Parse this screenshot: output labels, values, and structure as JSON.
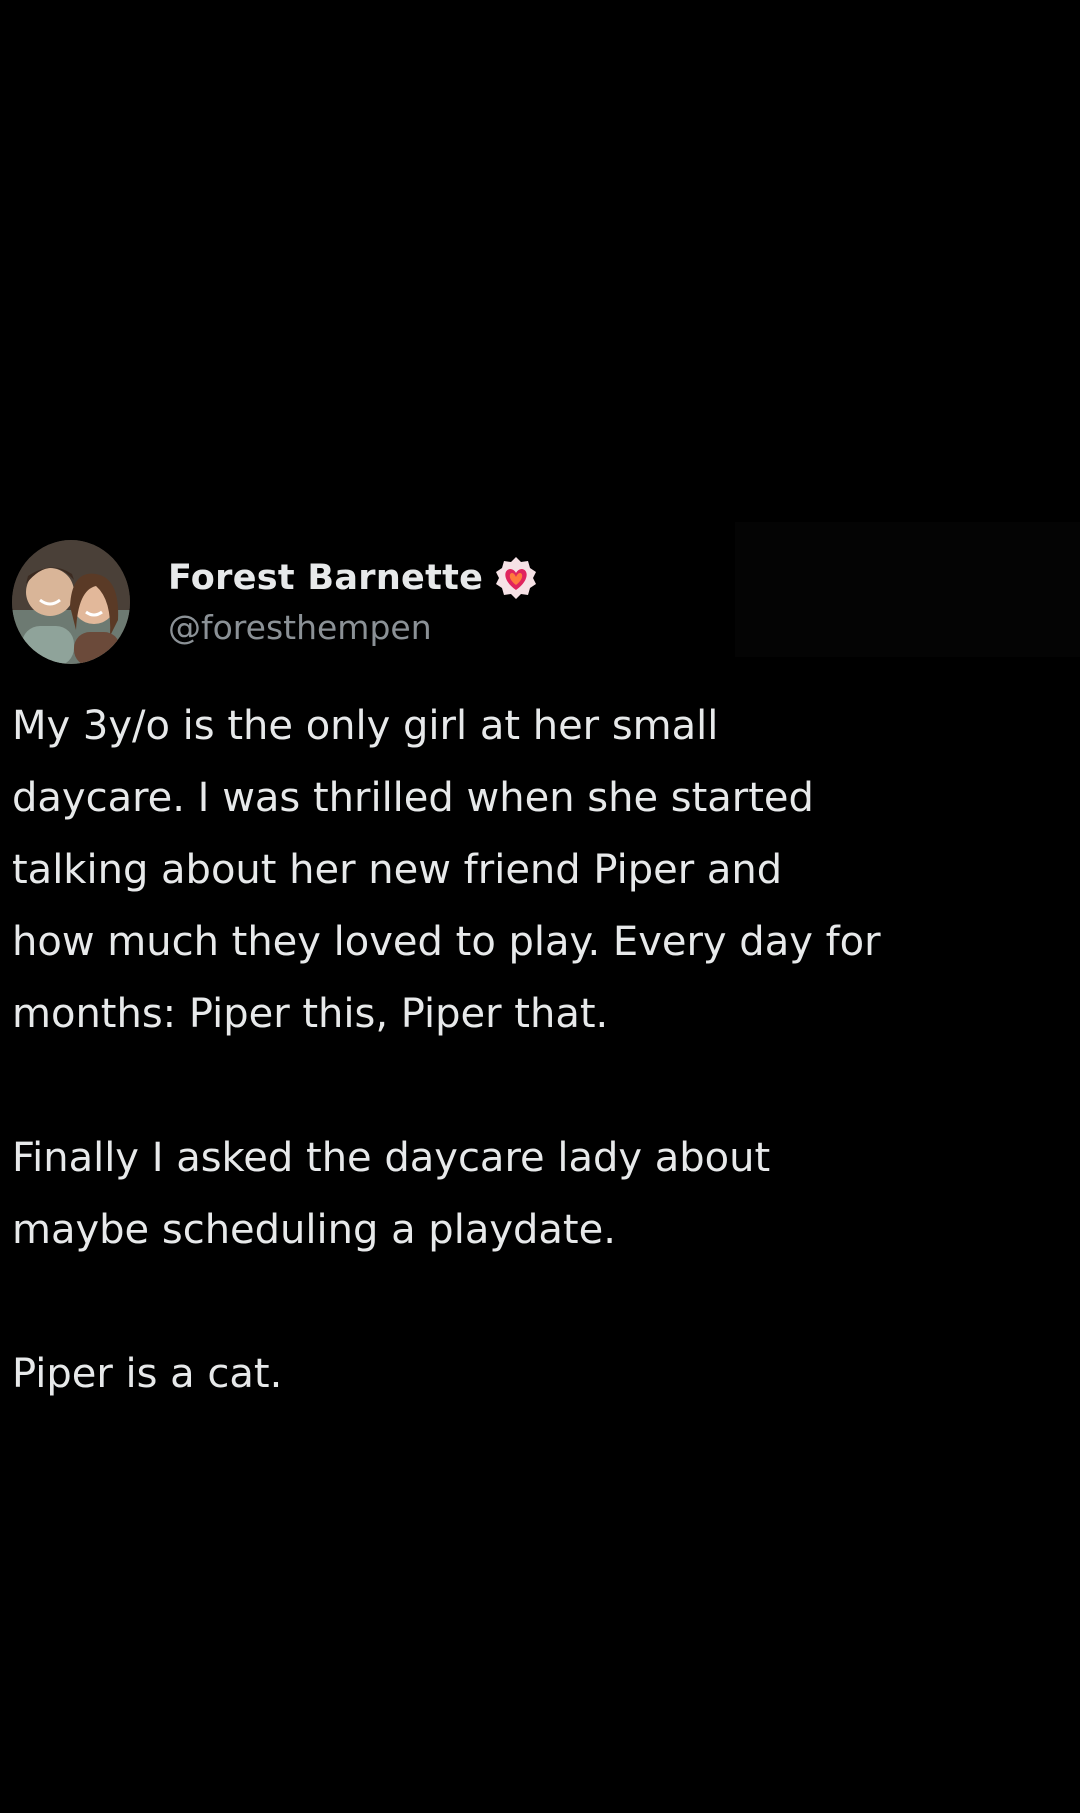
{
  "author": {
    "display_name": "Forest Barnette",
    "handle": "@foresthempen",
    "avatar_icon": "profile-photo",
    "badge_icon": "heart-badge-icon"
  },
  "tweet": {
    "paragraphs": [
      {
        "lines": [
          "My 3y/o is the only girl at her small",
          "daycare. I was thrilled when she started",
          "talking about her new friend Piper and",
          "how much they loved to play. Every day for",
          "months: Piper this, Piper that."
        ]
      },
      {
        "lines": [
          "Finally I asked the daycare lady about",
          "maybe scheduling a playdate."
        ]
      },
      {
        "lines": [
          "Piper is a cat."
        ]
      }
    ]
  },
  "colors": {
    "background": "#000000",
    "text": "#e7e9ea",
    "secondary_text": "#8b9196",
    "badge": "#e0245e"
  }
}
